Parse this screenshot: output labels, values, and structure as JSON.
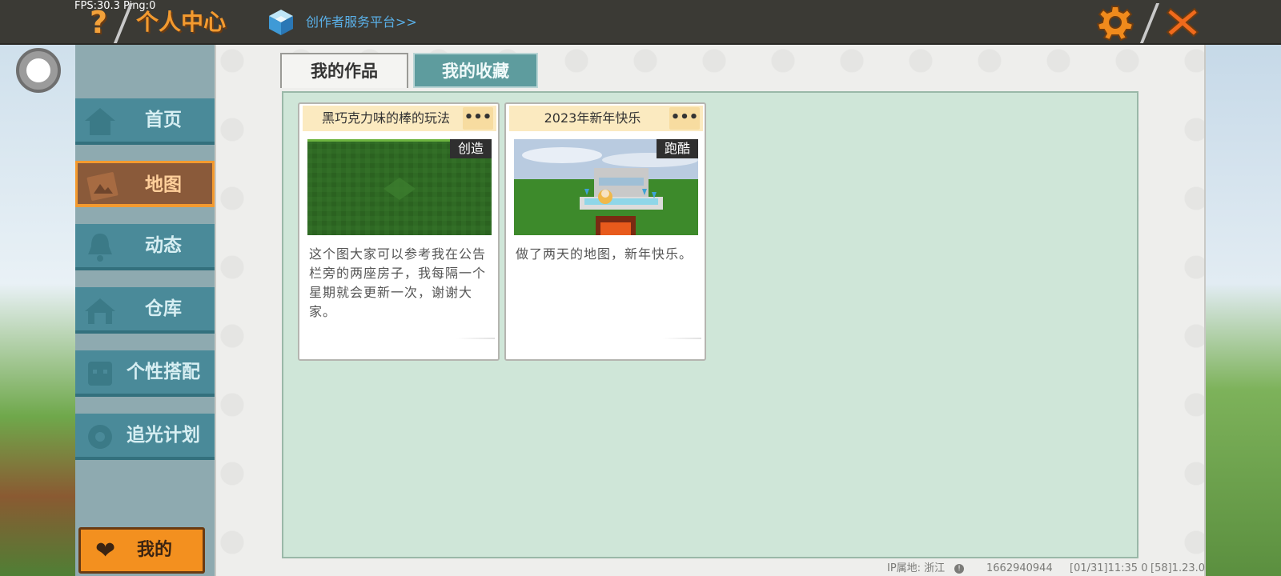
{
  "overlay": {
    "fps": "FPS:30.3  Ping:0"
  },
  "header": {
    "title": "个人中心",
    "creator_link": "创作者服务平台>>",
    "help_glyph": "?",
    "close_glyph": "✕"
  },
  "sidebar": {
    "items": [
      {
        "label": "首页",
        "icon": "home-icon"
      },
      {
        "label": "地图",
        "icon": "map-icon",
        "active": true
      },
      {
        "label": "动态",
        "icon": "bell-icon"
      },
      {
        "label": "仓库",
        "icon": "warehouse-icon"
      },
      {
        "label": "个性搭配",
        "icon": "avatar-icon"
      },
      {
        "label": "追光计划",
        "icon": "gear-icon"
      }
    ],
    "my_button": {
      "label": "我的",
      "icon": "heart-icon"
    }
  },
  "tabs": [
    {
      "label": "我的作品",
      "active": true
    },
    {
      "label": "我的收藏",
      "active": false
    }
  ],
  "cards": [
    {
      "title": "黑巧克力味的棒的玩法",
      "tag": "创造",
      "description": "这个图大家可以参考我在公告栏旁的两座房子，我每隔一个星期就会更新一次，谢谢大家。",
      "more": "•••"
    },
    {
      "title": "2023年新年快乐",
      "tag": "跑酷",
      "description": "做了两天的地图，新年快乐。",
      "more": "•••"
    }
  ],
  "status": {
    "ip_location": "IP属地: 浙江",
    "user_id": "1662940944",
    "timestamp": "[01/31]11:35 0",
    "version": "[58]1.23.0"
  },
  "colors": {
    "accent_orange": "#f39a2f",
    "nav_teal": "#4a8a99",
    "content_green": "#cfe6d8",
    "link_blue": "#5ab0e8"
  }
}
